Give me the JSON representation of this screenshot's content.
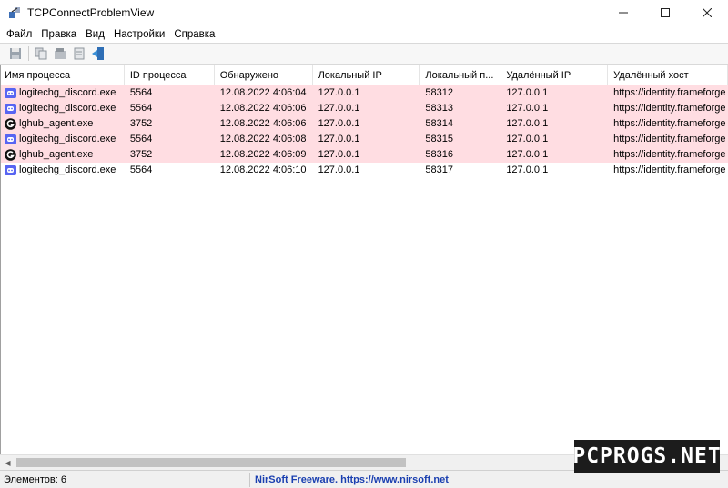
{
  "window": {
    "title": "TCPConnectProblemView",
    "icon": "network-plug-icon",
    "controls": [
      "minimize",
      "maximize",
      "close"
    ]
  },
  "menu": [
    {
      "label": "Файл",
      "icon": "none"
    },
    {
      "label": "Правка"
    },
    {
      "label": "Вид"
    },
    {
      "label": "Настройки"
    },
    {
      "label": "Справка"
    }
  ],
  "toolbar": {
    "buttons": [
      "save-icon",
      "copy-icon",
      "properties-icon",
      "html-report-icon",
      "exit-icon"
    ]
  },
  "table": {
    "columns": [
      "Имя процесса",
      "ID процесса",
      "Обнаружено",
      "Локальный IP",
      "Локальный п...",
      "Удалённый IP",
      "Удалённый хост"
    ],
    "rows": [
      {
        "name": "logitechg_discord.exe",
        "pid": "5564",
        "detected": "12.08.2022 4:06:04",
        "local_ip": "127.0.0.1",
        "local_port": "58312",
        "remote_ip": "127.0.0.1",
        "remote_host": "https://identity.frameforge",
        "icon": "discord-icon",
        "highlight": true
      },
      {
        "name": "logitechg_discord.exe",
        "pid": "5564",
        "detected": "12.08.2022 4:06:06",
        "local_ip": "127.0.0.1",
        "local_port": "58313",
        "remote_ip": "127.0.0.1",
        "remote_host": "https://identity.frameforge",
        "icon": "discord-icon",
        "highlight": true
      },
      {
        "name": "lghub_agent.exe",
        "pid": "3752",
        "detected": "12.08.2022 4:06:06",
        "local_ip": "127.0.0.1",
        "local_port": "58314",
        "remote_ip": "127.0.0.1",
        "remote_host": "https://identity.frameforge",
        "icon": "logitech-g-icon",
        "highlight": true
      },
      {
        "name": "logitechg_discord.exe",
        "pid": "5564",
        "detected": "12.08.2022 4:06:08",
        "local_ip": "127.0.0.1",
        "local_port": "58315",
        "remote_ip": "127.0.0.1",
        "remote_host": "https://identity.frameforge",
        "icon": "discord-icon",
        "highlight": true
      },
      {
        "name": "lghub_agent.exe",
        "pid": "3752",
        "detected": "12.08.2022 4:06:09",
        "local_ip": "127.0.0.1",
        "local_port": "58316",
        "remote_ip": "127.0.0.1",
        "remote_host": "https://identity.frameforge",
        "icon": "logitech-g-icon",
        "highlight": true
      },
      {
        "name": "logitechg_discord.exe",
        "pid": "5564",
        "detected": "12.08.2022 4:06:10",
        "local_ip": "127.0.0.1",
        "local_port": "58317",
        "remote_ip": "127.0.0.1",
        "remote_host": "https://identity.frameforge",
        "icon": "discord-icon",
        "highlight": false
      }
    ]
  },
  "status": {
    "count_text": "Элементов: 6",
    "link_text": "NirSoft Freeware. https://www.nirsoft.net"
  },
  "watermark": {
    "text": "PCPROGS.NET"
  },
  "colors": {
    "highlight_row": "#ffdde2",
    "link": "#1a3fb0",
    "discord": "#5865f2",
    "logitech": "#111111"
  }
}
